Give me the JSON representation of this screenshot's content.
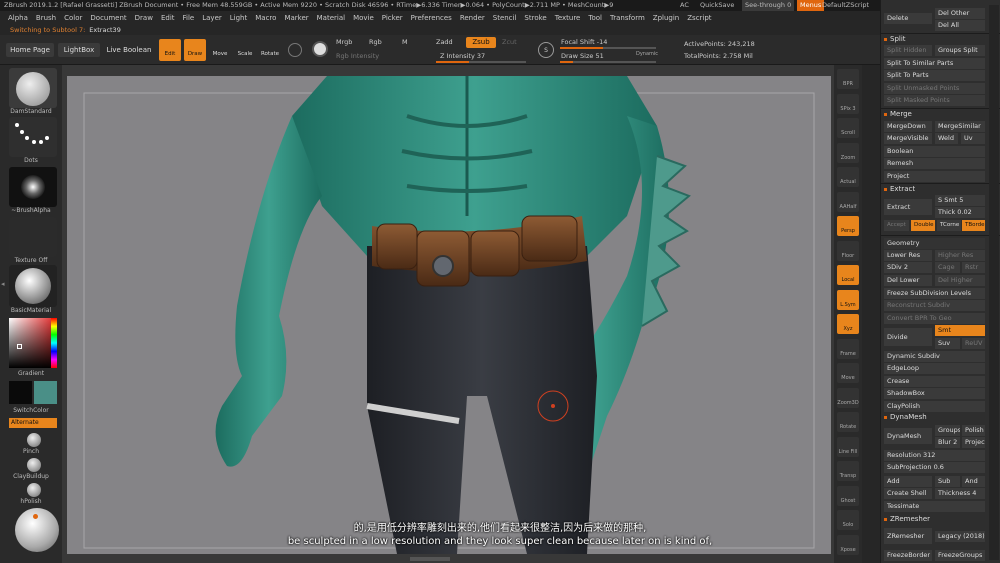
{
  "title_bar": {
    "text": "ZBrush 2019.1.2 [Rafael Grassetti]   ZBrush Document       • Free Mem 48.559GB • Active Mem 9220 • Scratch Disk 46596 • RTime▶6.336 Timer▶0.064 • PolyCount▶2.711 MP • MeshCount▶9",
    "ac": "AC",
    "quicksave": "QuickSave",
    "see_through": "See-through  0",
    "menus": "Menus",
    "default_script": "DefaultZScript"
  },
  "menus": [
    "Alpha",
    "Brush",
    "Color",
    "Document",
    "Draw",
    "Edit",
    "File",
    "Layer",
    "Light",
    "Macro",
    "Marker",
    "Material",
    "Movie",
    "Picker",
    "Preferences",
    "Render",
    "Stencil",
    "Stroke",
    "Texture",
    "Tool",
    "Transform",
    "Zplugin",
    "Zscript"
  ],
  "status": {
    "prefix": "Switching to Subtool 7:",
    "name": "Extract39"
  },
  "toolbar": {
    "home_page": "Home Page",
    "lightbox": "LightBox",
    "live_boolean": "Live Boolean",
    "edit": "Edit",
    "draw": "Draw",
    "move": "Move",
    "scale": "Scale",
    "rotate": "Rotate",
    "mrgb": "Mrgb",
    "rgb": "Rgb",
    "m": "M",
    "rgb_intensity": "Rgb Intensity",
    "zadd": "Zadd",
    "zsub": "Zsub",
    "zcut": "Zcut",
    "z_intensity": "Z Intensity 37",
    "z_intensity_value": 37,
    "focal_shift": "Focal Shift -14",
    "draw_size": "Draw Size 51",
    "dynamic": "Dynamic",
    "active_points": "ActivePoints: 243,218",
    "total_points": "TotalPoints: 2.758 Mil",
    "s_label": "S"
  },
  "left_shelf": {
    "brush": "DamStandard",
    "stroke": "Dots",
    "alpha": "~BrushAlpha",
    "texture": "Texture Off",
    "material": "BasicMaterial",
    "gradient": "Gradient",
    "switch_color": "SwitchColor",
    "alternate": "Alternate",
    "quick_brushes": [
      "Pinch",
      "ClayBuildup",
      "hPolish"
    ],
    "colors": {
      "primary": "#0a0a0a",
      "secondary": "#4a8f87"
    }
  },
  "right_shelf": {
    "items": [
      "BPR",
      "SPix 3",
      "Scroll",
      "Zoom",
      "Actual",
      "AAHalf",
      "Persp",
      "Floor",
      "Local",
      "L.Sym",
      "Xyz",
      "Frame",
      "Move",
      "Zoom3D",
      "Rotate",
      "Line Fill",
      "Transp",
      "Ghost",
      "Solo",
      "Xpose"
    ]
  },
  "right_panel": {
    "top": [
      "Delete",
      "Del Other",
      "Del All"
    ],
    "split_head": "Split",
    "split": [
      "Split Hidden",
      "Groups Split",
      "Split To Similar Parts",
      "Split To Parts",
      "Split Unmasked Points",
      "Split Masked Points"
    ],
    "merge_head": "Merge",
    "merge": [
      "MergeDown",
      "MergeSimilar",
      "MergeVisible",
      "Weld",
      "Uv",
      "Boolean",
      "Remesh",
      "Project"
    ],
    "extract_head": "Extract",
    "extract": {
      "button": "Extract",
      "s_smt": "S Smt 5",
      "thick": "Thick 0.02",
      "accept": "Accept",
      "double": "Double",
      "tcorne": "TCorne",
      "tborde": "TBorde"
    },
    "geometry_head": "Geometry",
    "geometry": {
      "lower_res": "Lower Res",
      "higher_res": "Higher Res",
      "sdiv": "SDiv 2",
      "cage": "Cage",
      "rstr": "Rstr",
      "del_lower": "Del Lower",
      "del_higher": "Del Higher",
      "freeze": "Freeze SubDivision Levels",
      "reconstruct": "Reconstruct Subdiv",
      "convert": "Convert BPR To Geo",
      "divide": "Divide",
      "smt": "Smt",
      "suv": "Suv",
      "reuv": "ReUV",
      "dynamic_subdiv": "Dynamic Subdiv",
      "edgeloop": "EdgeLoop",
      "crease": "Crease",
      "shadowbox": "ShadowBox",
      "claypolish": "ClayPolish"
    },
    "dynamesh_head": "DynaMesh",
    "dynamesh": {
      "button": "DynaMesh",
      "groups": "Groups",
      "polish": "Polish",
      "blur": "Blur 2",
      "project": "Project",
      "resolution": "Resolution 312",
      "subprojection": "SubProjection 0.6",
      "add": "Add",
      "sub": "Sub",
      "and": "And",
      "create_shell": "Create Shell",
      "thickness": "Thickness 4"
    },
    "tessimate": "Tessimate",
    "zremesher_head": "ZRemesher",
    "zremesher": {
      "button": "ZRemesher",
      "legacy": "Legacy (2018)",
      "freeze_border": "FreezeBorder",
      "freeze_groups": "FreezeGroups"
    }
  },
  "subtitles": {
    "chinese": "的,是用低分辨率雕刻出来的,他们看起来很整洁,因为后来做的那种,",
    "english": "be sculpted in a low resolution and they look super clean because later on is kind of,"
  }
}
